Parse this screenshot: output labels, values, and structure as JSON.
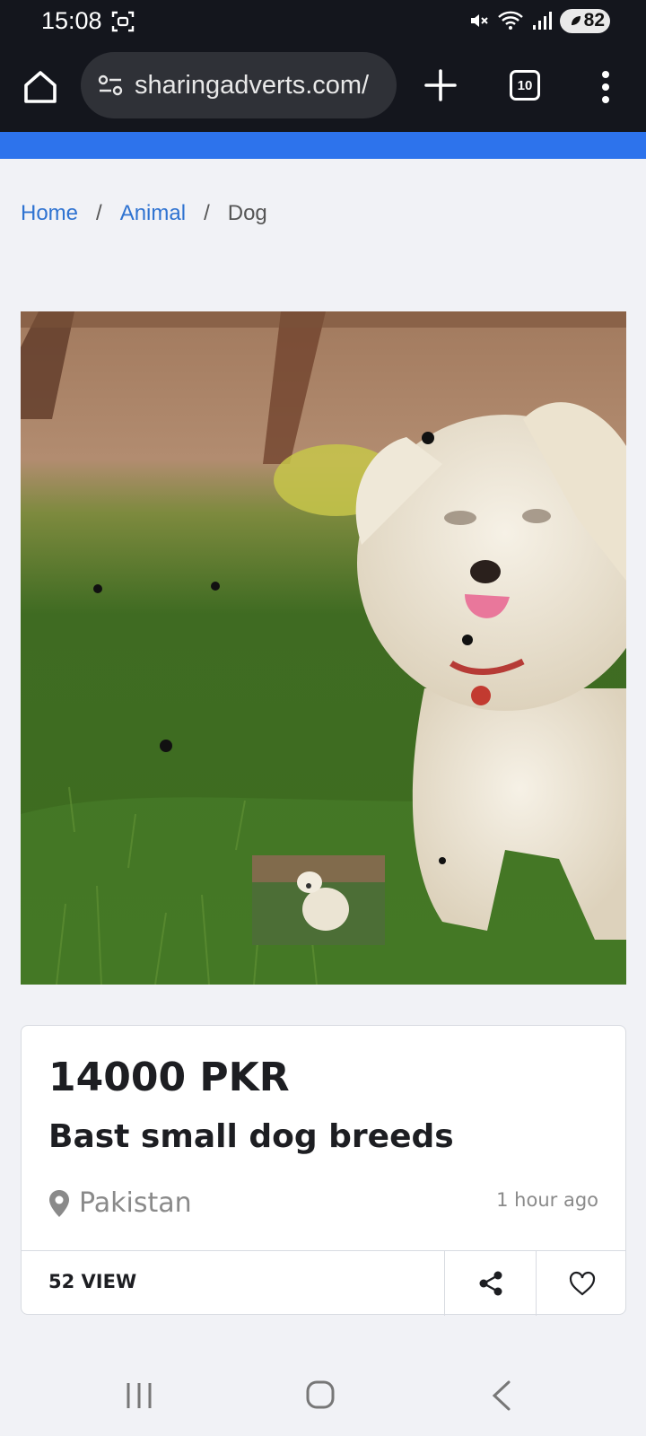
{
  "status_bar": {
    "time": "15:08",
    "battery": "82"
  },
  "browser": {
    "url": "sharingadverts.com/",
    "tab_count": "10"
  },
  "breadcrumb": {
    "home": "Home",
    "animal": "Animal",
    "current": "Dog",
    "separator": "/"
  },
  "listing": {
    "price": "14000 PKR",
    "title": "Bast small dog breeds",
    "location": "Pakistan",
    "posted": "1 hour ago",
    "views": "52 VIEW"
  },
  "colors": {
    "accent": "#2d73ec",
    "link": "#2f73d1",
    "chrome": "#14161d"
  },
  "icons": {
    "home": "home-icon",
    "site_settings": "site-settings-icon",
    "new_tab": "plus-icon",
    "menu": "more-vert-icon",
    "location": "location-pin-icon",
    "share": "share-icon",
    "favorite": "heart-icon"
  }
}
